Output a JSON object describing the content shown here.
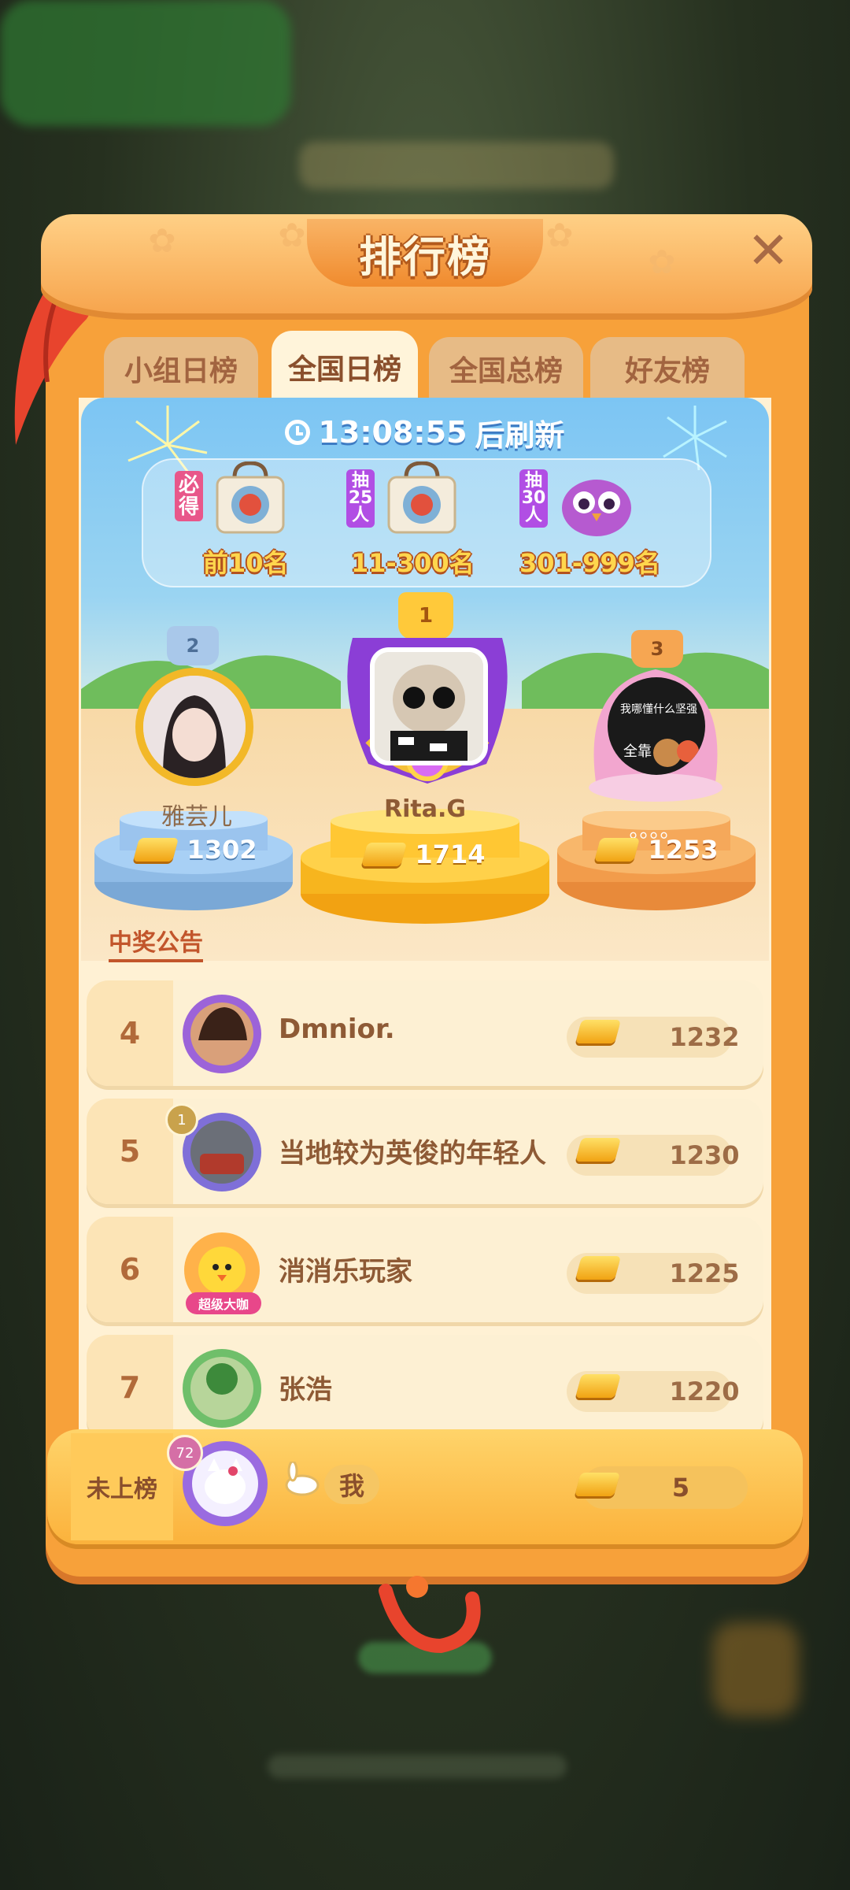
{
  "header": {
    "title": "排行榜"
  },
  "tabs": [
    {
      "label": "小组日榜",
      "active": false
    },
    {
      "label": "全国日榜",
      "active": true
    },
    {
      "label": "全国总榜",
      "active": false
    },
    {
      "label": "好友榜",
      "active": false
    }
  ],
  "refresh": {
    "time": "13:08:55",
    "suffix": "后刷新"
  },
  "prizes": [
    {
      "tag": "必得",
      "label": "前10名"
    },
    {
      "tag": "抽25人",
      "label": "11-300名"
    },
    {
      "tag": "抽30人",
      "label": "301-999名"
    }
  ],
  "podium": {
    "first": {
      "rank": "1",
      "name": "Rita.G",
      "score": "1714"
    },
    "second": {
      "rank": "2",
      "name": "雅芸儿",
      "score": "1302"
    },
    "third": {
      "rank": "3",
      "name": "。。。。",
      "score": "1253",
      "avatar_text_top": "我哪懂什么坚强",
      "avatar_text_bottom": "全靠"
    }
  },
  "notice_link": "中奖公告",
  "ranking": [
    {
      "rank": "4",
      "name": "Dmnior.",
      "score": "1232"
    },
    {
      "rank": "5",
      "name": "当地较为英俊的年轻人",
      "score": "1230",
      "level": "1"
    },
    {
      "rank": "6",
      "name": "消消乐玩家",
      "score": "1225",
      "badge": "超级大咖"
    },
    {
      "rank": "7",
      "name": "张浩",
      "score": "1220"
    }
  ],
  "me": {
    "rank_label": "未上榜",
    "name": "我",
    "score": "5",
    "level": "72"
  },
  "colors": {
    "panel": "#f7a13a",
    "accent": "#8a4f2c",
    "gold": "#ffd64d"
  }
}
